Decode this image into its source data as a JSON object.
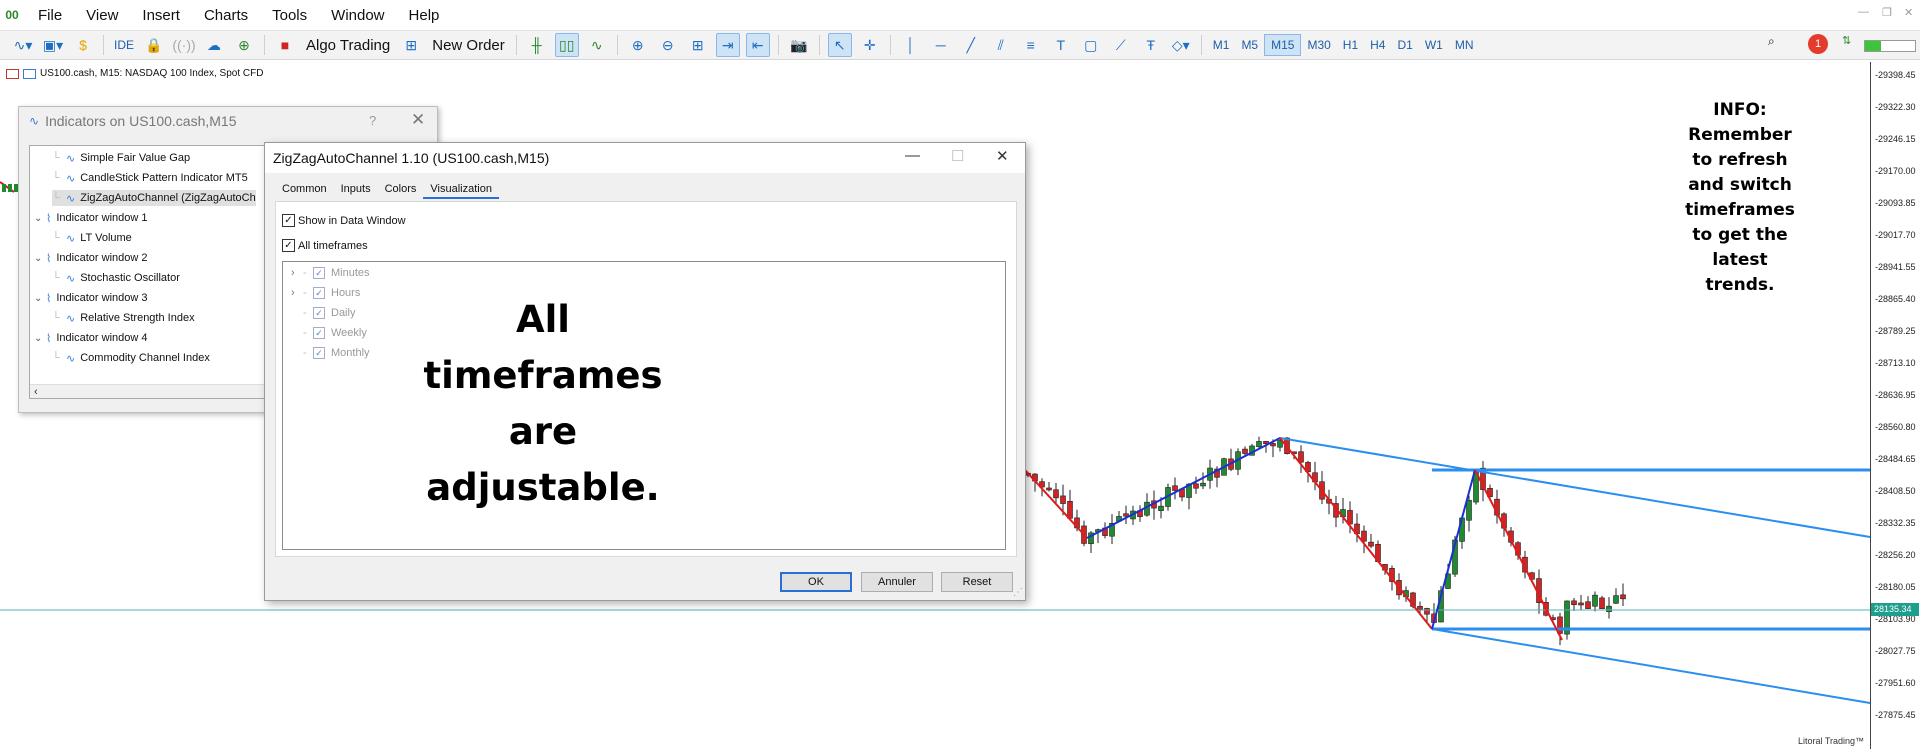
{
  "menubar": {
    "items": [
      "File",
      "View",
      "Insert",
      "Charts",
      "Tools",
      "Window",
      "Help"
    ]
  },
  "toolbar": {
    "ide_label": "IDE",
    "algo_trading_label": "Algo Trading",
    "new_order_label": "New Order",
    "timeframes": [
      "M1",
      "M5",
      "M15",
      "M30",
      "H1",
      "H4",
      "D1",
      "W1",
      "MN"
    ],
    "active_timeframe": "M15",
    "notification_count": "1"
  },
  "chart": {
    "title": "US100.cash, M15:  NASDAQ 100 Index, Spot CFD",
    "price_labels": [
      "29398.45",
      "29322.30",
      "29246.15",
      "29170.00",
      "29093.85",
      "29017.70",
      "28941.55",
      "28865.40",
      "28789.25",
      "28713.10",
      "28636.95",
      "28560.80",
      "28484.65",
      "28408.50",
      "28332.35",
      "28256.20",
      "28180.05",
      "28103.90",
      "28027.75",
      "27951.60",
      "27875.45"
    ],
    "current_price": "28135.34",
    "info_text": "INFO: Remember to refresh and switch timeframes to get the latest trends.",
    "copyright": "Litoral Trading™",
    "colors": {
      "up_candle": "#1f8a2f",
      "down_candle": "#d12424",
      "zigzag_up": "#1a2fd6",
      "zigzag_down": "#e01b1b",
      "channel": "#2a8ef0",
      "price_line": "#56b3b3"
    }
  },
  "indicators_window": {
    "title": "Indicators on US100.cash,M15",
    "help": "?",
    "tree": [
      {
        "label": "Simple Fair Value Gap",
        "level": 2
      },
      {
        "label": "CandleStick Pattern Indicator MT5",
        "level": 2
      },
      {
        "label": "ZigZagAutoChannel (ZigZagAutoCh",
        "level": 2,
        "selected": true
      },
      {
        "label": "Indicator window 1",
        "level": 1
      },
      {
        "label": "LT Volume",
        "level": 2
      },
      {
        "label": "Indicator window 2",
        "level": 1
      },
      {
        "label": "Stochastic Oscillator",
        "level": 2
      },
      {
        "label": "Indicator window 3",
        "level": 1
      },
      {
        "label": "Relative Strength Index",
        "level": 2
      },
      {
        "label": "Indicator window 4",
        "level": 1
      },
      {
        "label": "Commodity Channel Index",
        "level": 2
      }
    ]
  },
  "zigzag_dialog": {
    "title": "ZigZagAutoChannel 1.10 (US100.cash,M15)",
    "tabs": [
      "Common",
      "Inputs",
      "Colors",
      "Visualization"
    ],
    "active_tab": "Visualization",
    "show_in_data_window": "Show in Data Window",
    "all_timeframes": "All timeframes",
    "timeframe_tree": [
      "Minutes",
      "Hours",
      "Daily",
      "Weekly",
      "Monthly"
    ],
    "overlay_lines": [
      "All",
      "timeframes",
      "are",
      "adjustable."
    ],
    "ok_label": "OK",
    "cancel_label": "Annuler",
    "reset_label": "Reset"
  }
}
